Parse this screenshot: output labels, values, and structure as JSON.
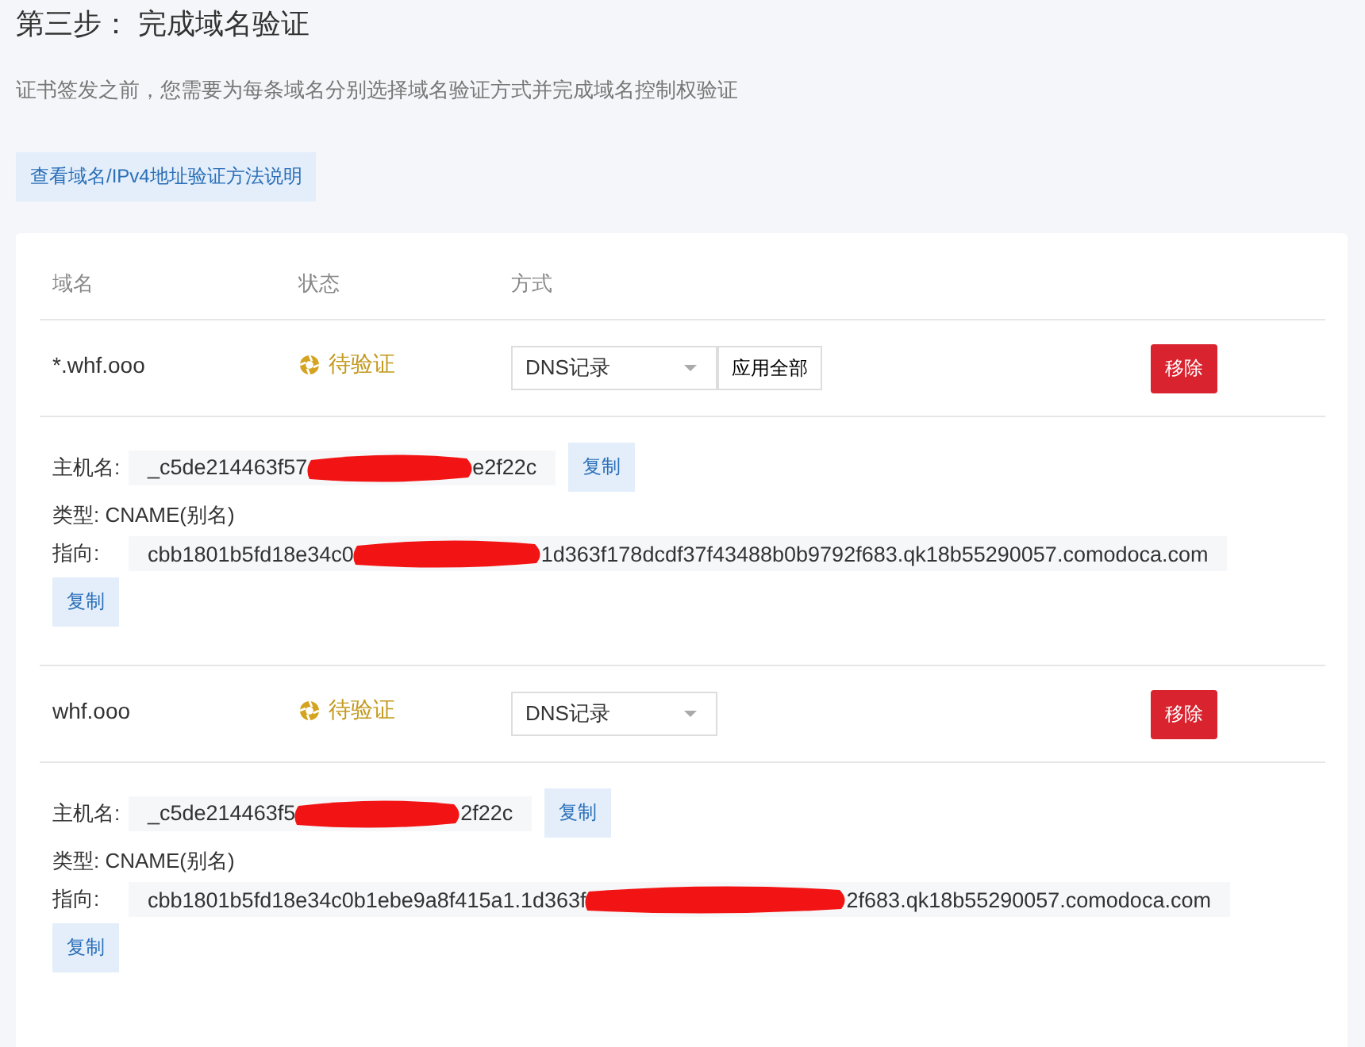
{
  "title": "第三步： 完成域名验证",
  "description": "证书签发之前，您需要为每条域名分别选择域名验证方式并完成域名控制权验证",
  "help_link": "查看域名/IPv4地址验证方法说明",
  "table": {
    "columns": [
      "域名",
      "状态",
      "方式"
    ],
    "rows": [
      {
        "domain": "*.whf.ooo",
        "status": "待验证",
        "method": "DNS记录",
        "apply_all": "应用全部",
        "remove": "移除",
        "details": {
          "host_label": "主机名:",
          "host_start": "_c5de214463f57",
          "host_end": "e2f22c",
          "host_redaction": {
            "kind": "short"
          },
          "copy_host": "复制",
          "type": "类型: CNAME(别名)",
          "target_label": "指向:",
          "target_start": "cbb1801b5fd18e34c0",
          "target_end": "1d363f178dcdf37f43488b0b9792f683.qk18b55290057.comodoca.com",
          "target_redaction": {
            "kind": "medium"
          },
          "copy_target": "复制"
        }
      },
      {
        "domain": "whf.ooo",
        "status": "待验证",
        "method": "DNS记录",
        "remove": "移除",
        "details": {
          "host_label": "主机名:",
          "host_start": "_c5de214463f5",
          "host_end": "2f22c",
          "host_redaction": {
            "kind": "short"
          },
          "copy_host": "复制",
          "type": "类型: CNAME(别名)",
          "target_label": "指向:",
          "target_start": "cbb1801b5fd18e34c0b1ebe9a8f415a1.1d363f",
          "target_end": "2f683.qk18b55290057.comodoca.com",
          "target_redaction": {
            "kind": "long"
          },
          "copy_target": "复制"
        }
      }
    ]
  }
}
